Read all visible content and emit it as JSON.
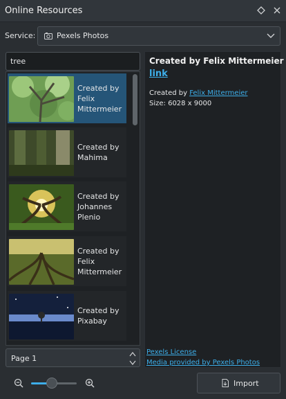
{
  "window": {
    "title": "Online Resources"
  },
  "service": {
    "label": "Service:",
    "value": "Pexels Photos"
  },
  "search": {
    "value": "tree"
  },
  "results": [
    {
      "caption": "Created by Felix Mittermeier",
      "selected": true,
      "thumb": "green forest canopy"
    },
    {
      "caption": "Created by Mahima",
      "selected": false,
      "thumb": "blurred tree trunks"
    },
    {
      "caption": "Created by Johannes Plenio",
      "selected": false,
      "thumb": "sunlit old tree"
    },
    {
      "caption": "Created by Felix Mittermeier",
      "selected": false,
      "thumb": "tree roots"
    },
    {
      "caption": "Created by Pixabay",
      "selected": false,
      "thumb": "tree under night sky"
    }
  ],
  "pager": {
    "value": "Page 1"
  },
  "detail": {
    "heading": "Created by Felix Mittermeier",
    "link": "link",
    "by_prefix": "Created by ",
    "author": "Felix Mittermeier",
    "size": "Size: 6028 x 9000",
    "license": "Pexels License",
    "provider": "Media provided by Pexels Photos"
  },
  "zoom": {
    "level": 0.45
  },
  "import_button": {
    "label": "Import"
  },
  "colors": {
    "accent": "#3daee9",
    "selection": "#255578",
    "background": "#2a2e32"
  },
  "icons": {
    "float": "diamond-float-icon",
    "close": "close-icon",
    "camera": "camera-icon",
    "chevron": "chevron-down-icon",
    "zoom_out": "zoom-out-icon",
    "zoom_in": "zoom-in-icon",
    "import": "import-file-icon"
  }
}
